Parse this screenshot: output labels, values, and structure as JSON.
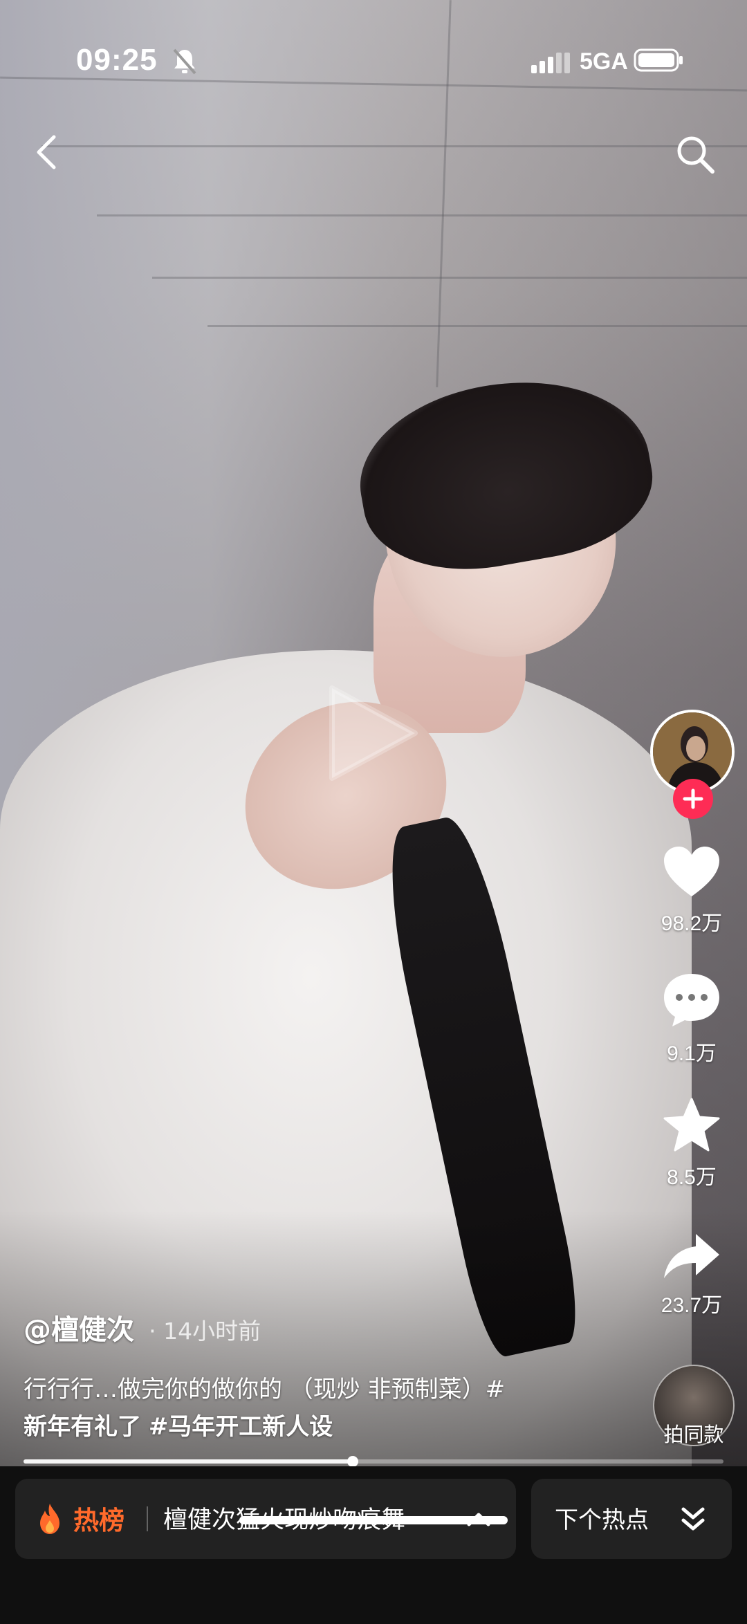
{
  "status_bar": {
    "time": "09:25",
    "network": "5GA",
    "icons": [
      "mute-icon",
      "signal-icon",
      "battery-icon"
    ]
  },
  "top_nav": {
    "icons": [
      "back-icon",
      "search-icon"
    ]
  },
  "video": {
    "progress": 0.47
  },
  "author": {
    "handle": "@檀健次",
    "time": "· 14小时前"
  },
  "caption": {
    "line1": "行行行…做完你的做你的 （现炒 非预制菜）#",
    "tag1": "新年有礼了",
    "tag2": "#马年开工新人设"
  },
  "right_rail": {
    "likes": "98.2万",
    "comments": "9.1万",
    "favorites": "8.5万",
    "shares": "23.7万",
    "follow_icon": "plus-icon",
    "same_style": "拍同款"
  },
  "bottom_bar": {
    "hot_label": "热榜",
    "hot_topic": "檀健次猛火现炒吻痕舞",
    "next_label": "下个热点",
    "icons": [
      "flame-icon",
      "chevron-up-icon",
      "double-chevron-down-icon"
    ]
  },
  "colors": {
    "follow": "#fe2c55",
    "hot": "#ff6a2b",
    "pill_bg": "#222222",
    "bar_bg": "#101010"
  }
}
